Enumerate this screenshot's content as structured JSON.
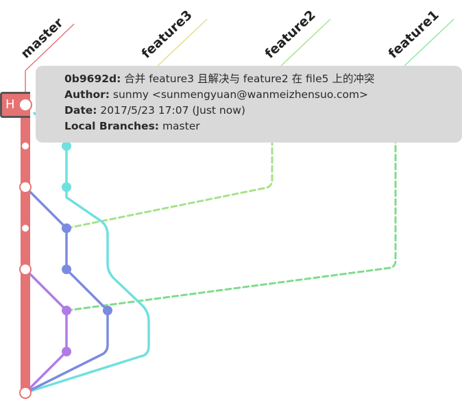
{
  "branches": [
    {
      "name": "master",
      "color": "#e57373"
    },
    {
      "name": "feature3",
      "color": "#e6dc8c"
    },
    {
      "name": "feature2",
      "color": "#a6e28a"
    },
    {
      "name": "feature1",
      "color": "#8fe6a8"
    }
  ],
  "head_badge": {
    "label": "H"
  },
  "tooltip": {
    "hash": "0b9692d:",
    "message": "合并 feature3 且解决与 feature2 在 file5 上的冲突",
    "author_key": "Author:",
    "author_value": "sunmy <sunmengyuan@wanmeizhensuo.com>",
    "date_key": "Date:",
    "date_value": "2017/5/23 17:07 (Just now)",
    "branches_key": "Local Branches:",
    "branches_value": "master"
  },
  "colors": {
    "master": "#e57373",
    "cyan": "#6ee0df",
    "blue": "#7b8be0",
    "purple": "#b07be6",
    "green_dashed_feature2": "#9ee07a",
    "green_dashed_feature1": "#7fdc8a",
    "tooltip_bg": "#d9d9d9"
  }
}
